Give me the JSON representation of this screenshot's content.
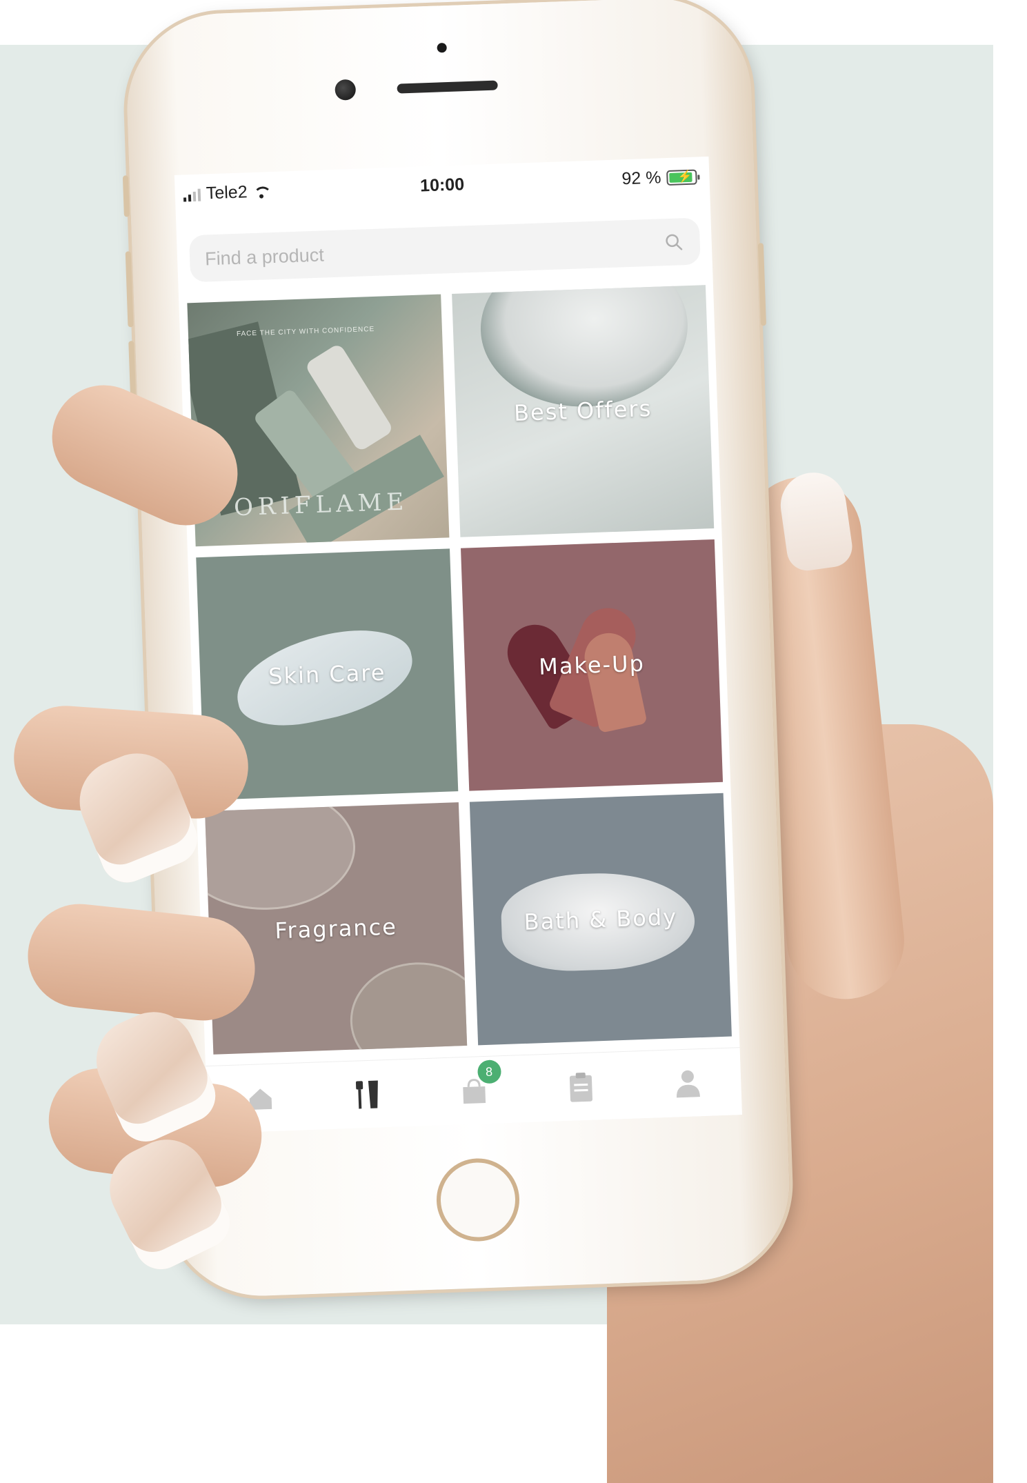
{
  "status_bar": {
    "carrier": "Tele2",
    "time": "10:00",
    "battery": "92 %",
    "battery_level": 0.92
  },
  "search": {
    "placeholder": "Find a product"
  },
  "categories": [
    {
      "label": "",
      "brand_wordmark": "ORIFLAME",
      "tagline": "FACE THE CITY WITH CONFIDENCE"
    },
    {
      "label": "Best Offers"
    },
    {
      "label": "Skin Care"
    },
    {
      "label": "Make-Up"
    },
    {
      "label": "Fragrance"
    },
    {
      "label": "Bath & Body"
    }
  ],
  "tab_bar": {
    "items": [
      {
        "icon": "home-icon",
        "active": false
      },
      {
        "icon": "beauty-products-icon",
        "active": true
      },
      {
        "icon": "bag-icon",
        "active": false,
        "badge": "8"
      },
      {
        "icon": "clipboard-icon",
        "active": false
      },
      {
        "icon": "profile-icon",
        "active": false
      }
    ]
  },
  "colors": {
    "active_tab": "#333333",
    "inactive_tab": "#c8c8c8",
    "badge": "#4caf72",
    "backdrop": "#e3ebe8"
  }
}
